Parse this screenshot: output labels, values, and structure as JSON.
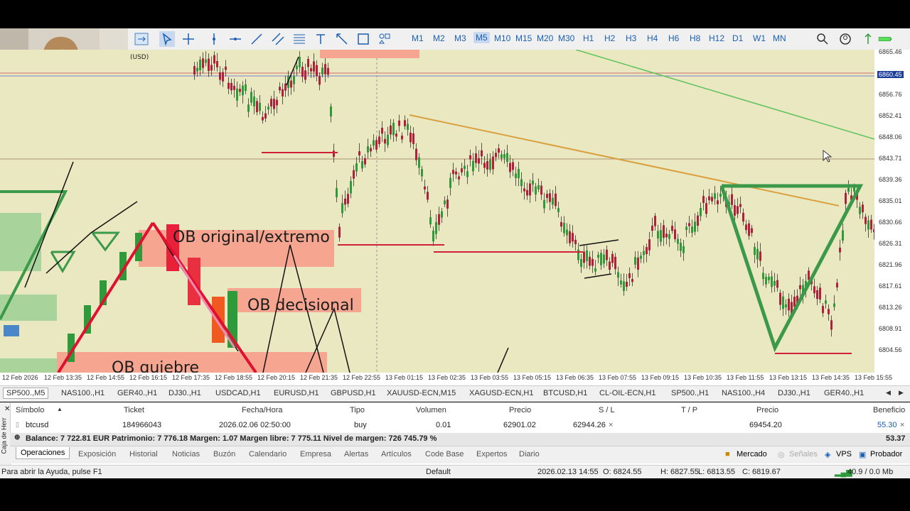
{
  "toolbar": {
    "timeframes": [
      "M1",
      "M2",
      "M3",
      "M5",
      "M10",
      "M15",
      "M20",
      "M30",
      "H1",
      "H2",
      "H3",
      "H4",
      "H6",
      "H8",
      "H12",
      "D1",
      "W1",
      "MN"
    ],
    "active_timeframe": "M5"
  },
  "chart": {
    "currency_label": "(USD)",
    "current_price_badge": "6860.45",
    "price_labels": [
      "6865.46",
      "6860.45",
      "6856.76",
      "6852.41",
      "6848.06",
      "6843.71",
      "6839.36",
      "6835.01",
      "6830.66",
      "6826.31",
      "6821.96",
      "6817.61",
      "6813.26",
      "6808.91",
      "6804.56"
    ],
    "time_labels": [
      "12 Feb 2026",
      "12 Feb 13:35",
      "12 Feb 14:55",
      "12 Feb 16:15",
      "12 Feb 17:35",
      "12 Feb 18:55",
      "12 Feb 20:15",
      "12 Feb 21:35",
      "12 Feb 22:55",
      "13 Feb 01:15",
      "13 Feb 02:35",
      "13 Feb 03:55",
      "13 Feb 05:15",
      "13 Feb 06:35",
      "13 Feb 07:55",
      "13 Feb 09:15",
      "13 Feb 10:35",
      "13 Feb 11:55",
      "13 Feb 13:15",
      "13 Feb 14:35",
      "13 Feb 15:55"
    ],
    "annotations": {
      "ob_original": "OB original/extremo",
      "ob_decisional": "OB decisional",
      "ob_quiebre": "OB quiebre"
    }
  },
  "symbol_tabs": [
    "SP500.,M5",
    "NAS100.,H1",
    "GER40.,H1",
    "DJ30.,H1",
    "USDCAD,H1",
    "EURUSD,H1",
    "GBPUSD,H1",
    "XAUUSD-ECN,M15",
    "XAGUSD-ECN,H1",
    "BTCUSD,H1",
    "CL-OIL-ECN,H1",
    "SP500.,H1",
    "NAS100.,H4",
    "DJ30.,H1",
    "GER40.,H1"
  ],
  "terminal": {
    "side_label": "Caja de Herr",
    "headers": {
      "symbol": "Símbolo",
      "ticket": "Ticket",
      "time": "Fecha/Hora",
      "type": "Tipo",
      "volume": "Volumen",
      "price": "Precio",
      "sl": "S / L",
      "tp": "T / P",
      "cur_price": "Precio",
      "profit": "Beneficio"
    },
    "row": {
      "symbol": "btcusd",
      "ticket": "184966043",
      "time": "2026.02.06 02:50:00",
      "type": "buy",
      "volume": "0.01",
      "price": "62901.02",
      "sl": "62944.26",
      "close_x": "×",
      "cur_price": "69454.20",
      "profit": "55.30"
    },
    "balance_text": "Balance: 7 722.81 EUR  Patrimonio: 7 776.18  Margen: 1.07  Margen libre: 7 775.11  Nivel de margen: 726 745.79 %",
    "total_profit": "53.37"
  },
  "bottom_tabs": [
    "Operaciones",
    "Exposición",
    "Historial",
    "Noticias",
    "Buzón",
    "Calendario",
    "Empresa",
    "Alertas",
    "Artículos",
    "Code Base",
    "Expertos",
    "Diario"
  ],
  "right_tabs": [
    "Mercado",
    "Señales",
    "VPS",
    "Probador"
  ],
  "status": {
    "help": "Para abrir la Ayuda, pulse F1",
    "profile": "Default",
    "datetime": "2026.02.13 14:55",
    "open": "O: 6824.55",
    "high": "H: 6827.55",
    "low": "L: 6813.55",
    "close": "C: 6819.67",
    "connection": "40.9 / 0.0 Mb"
  },
  "colors": {
    "chart_bg": "#eae8c0",
    "ob_box": "#f6a590",
    "green_marker": "#3a9a4a",
    "red_level": "#d0203a",
    "accent": "#1a5fb4"
  }
}
